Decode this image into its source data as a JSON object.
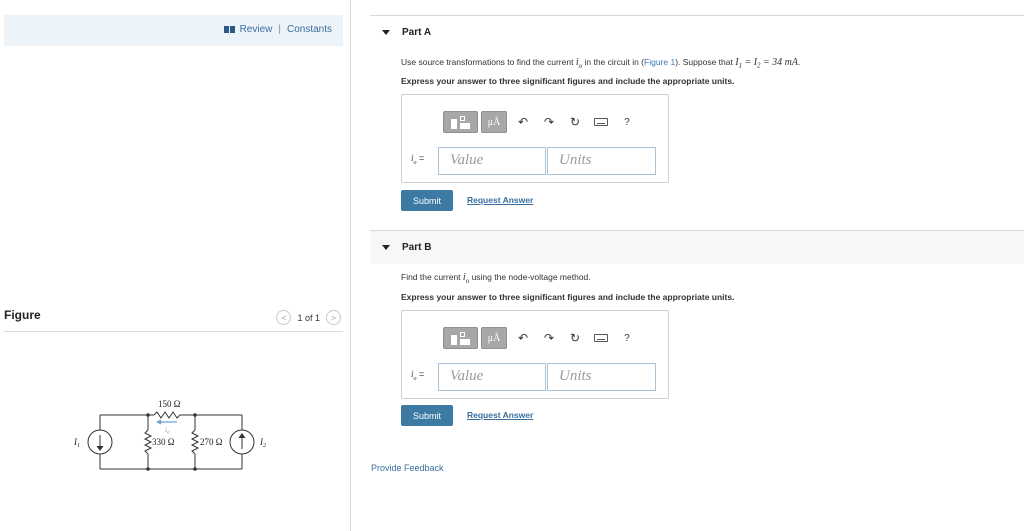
{
  "header": {
    "review_label": "Review",
    "separator": "|",
    "constants_label": "Constants"
  },
  "figure": {
    "title": "Figure",
    "pager": "1 of 1",
    "prev_glyph": "<",
    "next_glyph": ">",
    "circuit": {
      "r_top": "150 Ω",
      "r_left": "330 Ω",
      "r_right": "270 Ω",
      "source_left": "I",
      "source_left_sub": "1",
      "source_right": "I",
      "source_right_sub": "2",
      "current_label": "i",
      "current_sub": "o"
    }
  },
  "part_a": {
    "title": "Part A",
    "question_1": "Use source transformations to find the current",
    "var": "i",
    "var_sub": "o",
    "question_2": "in the circuit in (",
    "figure_link": "Figure 1",
    "question_3": "). Suppose that",
    "condition": "I",
    "condition_rest": "= I",
    "condition_value": "= 34 mA",
    "condition_end": ".",
    "instruction": "Express your answer to three significant figures and include the appropriate units.",
    "answer_label": "i",
    "answer_sub": "o",
    "answer_eq": " =",
    "value_placeholder": "Value",
    "units_placeholder": "Units",
    "submit": "Submit",
    "request": "Request Answer"
  },
  "part_b": {
    "title": "Part B",
    "question_1": "Find the current",
    "var": "i",
    "var_sub": "o",
    "question_2": "using the node-voltage method.",
    "instruction": "Express your answer to three significant figures and include the appropriate units.",
    "answer_label": "i",
    "answer_sub": "o",
    "answer_eq": " =",
    "value_placeholder": "Value",
    "units_placeholder": "Units",
    "submit": "Submit",
    "request": "Request Answer"
  },
  "toolbar": {
    "units_button": "μÅ",
    "undo": "↶",
    "redo": "↷",
    "reset": "↻",
    "help": "?",
    "icons": [
      "template-icon",
      "units-icon",
      "undo-icon",
      "redo-icon",
      "reset-icon",
      "keyboard-icon",
      "help-icon"
    ]
  },
  "footer": {
    "feedback": "Provide Feedback"
  },
  "colors": {
    "accent": "#3d7aa3",
    "link": "#3a6e9d",
    "header_bg": "#ecf3f9",
    "toolbar_btn": "#a7a7a7"
  }
}
